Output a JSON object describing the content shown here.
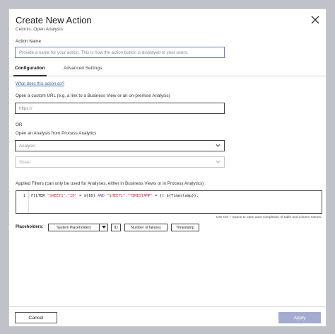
{
  "dialog": {
    "title": "Create New Action",
    "subtitle": "Celonis: Open Analysis"
  },
  "action_name": {
    "label": "Action Name",
    "placeholder": "Provide a name for your action. This is how the action button is displayed to your users."
  },
  "tabs": [
    {
      "label": "Configuration",
      "active": true
    },
    {
      "label": "Advanced Settings",
      "active": false
    }
  ],
  "help_link": "What does this action do?",
  "custom_url": {
    "label": "Open a custom URL (e.g. a link to a Business View or an on-premise Analysis)",
    "placeholder": "https://"
  },
  "or_label": "OR",
  "analysis": {
    "label": "Open an Analysis from Process Analytics",
    "analysis_value": "Analysis",
    "sheet_value": "Sheet"
  },
  "filters": {
    "label": "Applied Filters (can only be used for Analyses, either in Business Views or in Process Analytics)",
    "line_number": "1",
    "code": {
      "t1": "FILTER ",
      "t2": "\"SHEET1\".\"ID\"",
      "t3": " = ${ID} ",
      "t4": "AND",
      "t5": " ",
      "t6": "\"SHEET1\".\"TIMESTAMP\"",
      "t7": " = {t ${Timestamp}};"
    },
    "hint": "Use Ctrl + Space to open auto-completion of table and column names"
  },
  "placeholders": {
    "label": "Placeholders:",
    "dropdown": "System Placeholders",
    "chips": [
      "ID",
      "Number of failures",
      "Timestamp"
    ]
  },
  "footer": {
    "cancel": "Cancel",
    "apply": "Apply"
  },
  "colors": {
    "link": "#3a63b8",
    "focus_border": "#6d7fbd",
    "apply_bg": "#a3acd0"
  }
}
